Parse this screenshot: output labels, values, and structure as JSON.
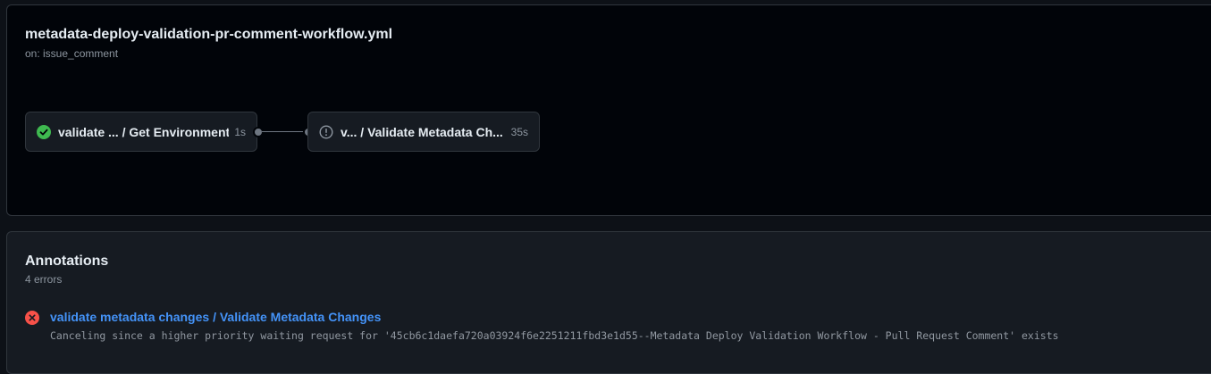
{
  "workflow": {
    "title": "metadata-deploy-validation-pr-comment-workflow.yml",
    "trigger": "on: issue_comment",
    "jobs": [
      {
        "label": "validate ...  / Get Environment",
        "duration": "1s",
        "status": "success",
        "icon": "check-circle-fill-icon",
        "status_color": "#3fb950"
      },
      {
        "label": "v... / Validate Metadata Ch...",
        "duration": "35s",
        "status": "cancelled",
        "icon": "alert-circle-icon",
        "status_color": "#8d96a0"
      }
    ]
  },
  "annotations": {
    "title": "Annotations",
    "count": "4 errors",
    "items": [
      {
        "icon": "x-circle-fill-icon",
        "icon_color": "#f85149",
        "link": "validate metadata changes / Validate Metadata Changes",
        "message": "Canceling since a higher priority waiting request for '45cb6c1daefa720a03924f6e2251211fbd3e1d55--Metadata Deploy Validation Workflow - Pull Request Comment' exists"
      }
    ]
  },
  "colors": {
    "background": "#0d1117",
    "panel": "#010409",
    "link": "#4493f8",
    "border": "#30363d"
  }
}
